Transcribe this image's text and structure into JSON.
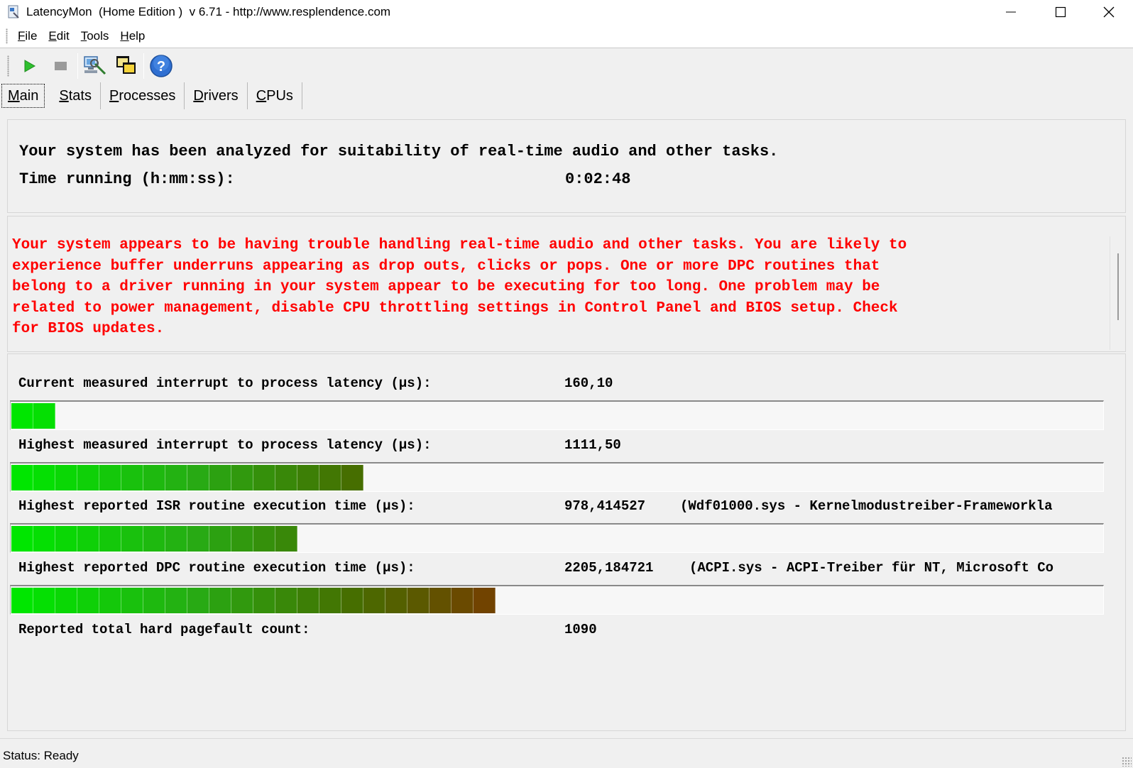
{
  "window": {
    "title": "LatencyMon  (Home Edition )  v 6.71 - http://www.resplendence.com"
  },
  "menu": [
    {
      "key": "F",
      "rest": "ile"
    },
    {
      "key": "E",
      "rest": "dit"
    },
    {
      "key": "T",
      "rest": "ools"
    },
    {
      "key": "H",
      "rest": "elp"
    }
  ],
  "toolbar": {
    "icons": [
      "play-icon",
      "stop-icon",
      "computer-analyze-icon",
      "windows-icon",
      "help-icon"
    ]
  },
  "tabs": [
    {
      "key": "M",
      "rest": "ain",
      "active": true
    },
    {
      "key": "S",
      "rest": "tats"
    },
    {
      "key": "P",
      "rest": "rocesses"
    },
    {
      "key": "D",
      "rest": "rivers"
    },
    {
      "key": "C",
      "rest": "PUs"
    }
  ],
  "summary": {
    "analyzed_text": "Your system has been analyzed for suitability of real-time audio and other tasks.",
    "time_label": "Time running (h:mm:ss):",
    "time_value": "0:02:48"
  },
  "warning": {
    "text": "Your system appears to be having trouble handling real-time audio and other tasks. You are likely to\nexperience buffer underruns appearing as drop outs, clicks or pops. One or more DPC routines that\nbelong to a driver running in your system appear to be executing for too long. One problem may be\nrelated to power management, disable CPU throttling settings in Control Panel and BIOS setup. Check\nfor BIOS updates.",
    "color": "#ff0000"
  },
  "metrics": {
    "current_latency": {
      "label": "Current measured interrupt to process latency (µs):",
      "value": "160,10",
      "bar_segments": 2
    },
    "highest_latency": {
      "label": "Highest measured interrupt to process latency (µs):",
      "value": "1111,50",
      "bar_segments": 16
    },
    "isr_time": {
      "label": "Highest reported ISR routine execution time (µs):",
      "value": "978,414527",
      "detail": "(Wdf01000.sys - Kernelmodustreiber-Frameworkla",
      "bar_segments": 13
    },
    "dpc_time": {
      "label": "Highest reported DPC routine execution time (µs):",
      "value": "2205,184721",
      "detail": "(ACPI.sys - ACPI-Treiber für NT, Microsoft Co",
      "bar_segments": 22
    },
    "pagefault": {
      "label": "Reported total hard pagefault count:",
      "value": "1090"
    }
  },
  "status": {
    "text": "Status: Ready"
  }
}
